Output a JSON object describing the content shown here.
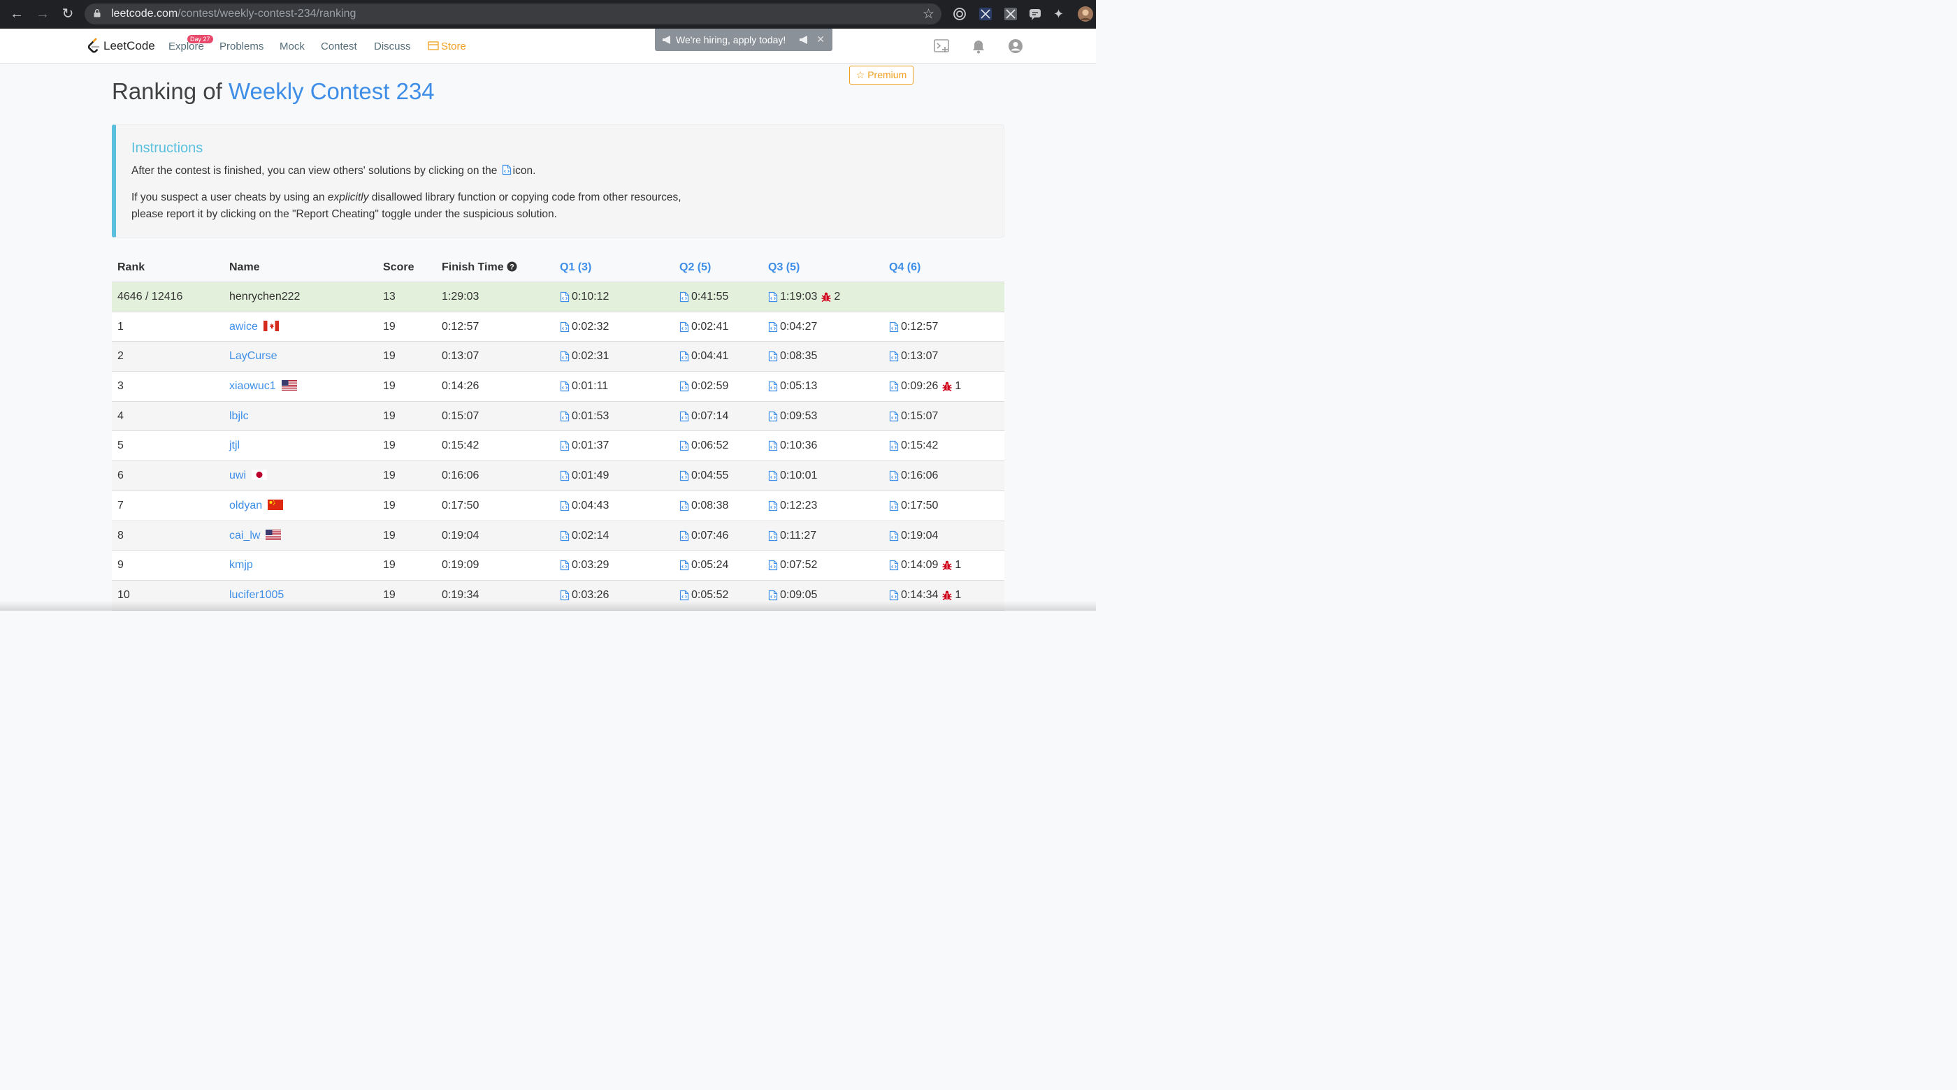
{
  "browser": {
    "url_host": "leetcode.com",
    "url_path": "/contest/weekly-contest-234/ranking"
  },
  "navbar": {
    "logo_text": "LeetCode",
    "day_badge": "Day 27",
    "links": {
      "explore": "Explore",
      "problems": "Problems",
      "mock": "Mock",
      "contest": "Contest",
      "discuss": "Discuss",
      "store": "Store"
    },
    "hiring_banner": "We're hiring, apply today!",
    "premium": "Premium"
  },
  "page": {
    "title_prefix": "Ranking of",
    "contest_name": "Weekly Contest 234"
  },
  "instructions": {
    "title": "Instructions",
    "line1_before": "After the contest is finished, you can view others' solutions by clicking on the",
    "line1_after": "icon.",
    "line2_before": "If you suspect a user cheats by using an",
    "line2_emph": "explicitly",
    "line2_after": "disallowed library function or copying code from other resources,",
    "line3": "please report it by clicking on the \"Report Cheating\" toggle under the suspicious solution."
  },
  "table": {
    "headers": {
      "rank": "Rank",
      "name": "Name",
      "score": "Score",
      "finish": "Finish Time",
      "q1": "Q1 (3)",
      "q2": "Q2 (5)",
      "q3": "Q3 (5)",
      "q4": "Q4 (6)"
    },
    "current_user": {
      "rank": "4646 / 12416",
      "name": "henrychen222",
      "score": "13",
      "finish": "1:29:03",
      "q1": "0:10:12",
      "q2": "0:41:55",
      "q3": "1:19:03",
      "q3_bugs": "2"
    },
    "rows": [
      {
        "rank": "1",
        "name": "awice",
        "flag": "CA",
        "score": "19",
        "finish": "0:12:57",
        "q1": "0:02:32",
        "q2": "0:02:41",
        "q3": "0:04:27",
        "q4": "0:12:57",
        "q4_bugs": ""
      },
      {
        "rank": "2",
        "name": "LayCurse",
        "flag": "",
        "score": "19",
        "finish": "0:13:07",
        "q1": "0:02:31",
        "q2": "0:04:41",
        "q3": "0:08:35",
        "q4": "0:13:07",
        "q4_bugs": ""
      },
      {
        "rank": "3",
        "name": "xiaowuc1",
        "flag": "US",
        "score": "19",
        "finish": "0:14:26",
        "q1": "0:01:11",
        "q2": "0:02:59",
        "q3": "0:05:13",
        "q4": "0:09:26",
        "q4_bugs": "1"
      },
      {
        "rank": "4",
        "name": "lbjlc",
        "flag": "",
        "score": "19",
        "finish": "0:15:07",
        "q1": "0:01:53",
        "q2": "0:07:14",
        "q3": "0:09:53",
        "q4": "0:15:07",
        "q4_bugs": ""
      },
      {
        "rank": "5",
        "name": "jtjl",
        "flag": "",
        "score": "19",
        "finish": "0:15:42",
        "q1": "0:01:37",
        "q2": "0:06:52",
        "q3": "0:10:36",
        "q4": "0:15:42",
        "q4_bugs": ""
      },
      {
        "rank": "6",
        "name": "uwi",
        "flag": "JP",
        "score": "19",
        "finish": "0:16:06",
        "q1": "0:01:49",
        "q2": "0:04:55",
        "q3": "0:10:01",
        "q4": "0:16:06",
        "q4_bugs": ""
      },
      {
        "rank": "7",
        "name": "oldyan",
        "flag": "CN",
        "score": "19",
        "finish": "0:17:50",
        "q1": "0:04:43",
        "q2": "0:08:38",
        "q3": "0:12:23",
        "q4": "0:17:50",
        "q4_bugs": ""
      },
      {
        "rank": "8",
        "name": "cai_lw",
        "flag": "US",
        "score": "19",
        "finish": "0:19:04",
        "q1": "0:02:14",
        "q2": "0:07:46",
        "q3": "0:11:27",
        "q4": "0:19:04",
        "q4_bugs": ""
      },
      {
        "rank": "9",
        "name": "kmjp",
        "flag": "",
        "score": "19",
        "finish": "0:19:09",
        "q1": "0:03:29",
        "q2": "0:05:24",
        "q3": "0:07:52",
        "q4": "0:14:09",
        "q4_bugs": "1"
      },
      {
        "rank": "10",
        "name": "lucifer1005",
        "flag": "",
        "score": "19",
        "finish": "0:19:34",
        "q1": "0:03:26",
        "q2": "0:05:52",
        "q3": "0:09:05",
        "q4": "0:14:34",
        "q4_bugs": "1"
      }
    ]
  },
  "colors": {
    "link_blue": "#3e8ee8",
    "instructions_accent": "#5bc0de",
    "current_user_row": "#e3f0db",
    "bug_red": "#d0021b",
    "store_orange": "#f0a020"
  },
  "icons": {
    "solution": "code-file-icon",
    "wrong_submission": "bug-icon",
    "help": "question-circle-icon"
  }
}
